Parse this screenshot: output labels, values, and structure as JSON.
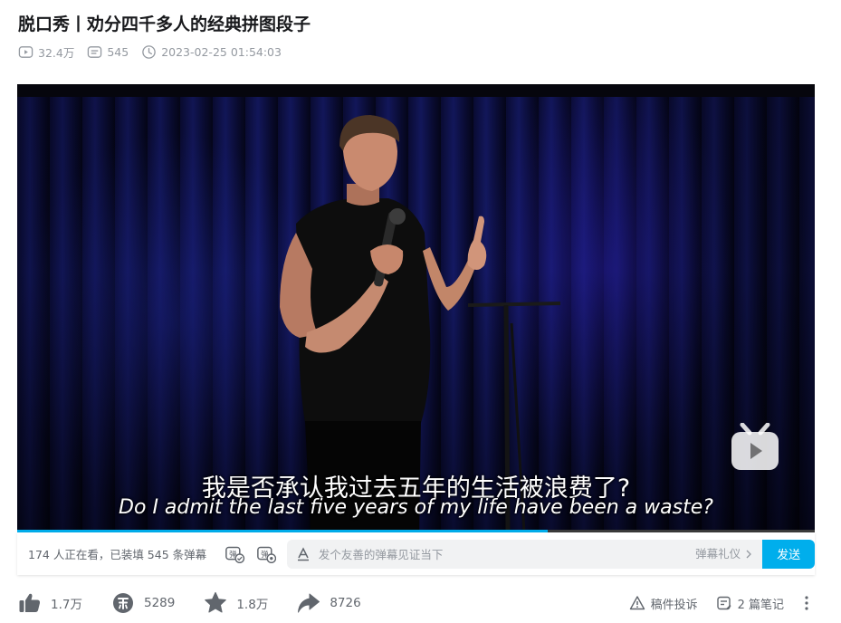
{
  "video": {
    "title": "脱口秀丨劝分四千多人的经典拼图段子",
    "views": "32.4万",
    "danmaku_count": "545",
    "publish_time": "2023-02-25 01:54:03"
  },
  "player": {
    "subtitle_cn": "我是否承认我过去五年的生活被浪费了?",
    "subtitle_en": "Do I admit the last five years of my life have been a waste?",
    "progress": 0.665
  },
  "danmaku_bar": {
    "viewers_text": "174 人正在看，已装填 545 条弹幕",
    "input_placeholder": "发个友善的弹幕见证当下",
    "etiquette_label": "弹幕礼仪",
    "send_label": "发送"
  },
  "toolbar": {
    "like_count": "1.7万",
    "coin_count": "5289",
    "favorite_count": "1.8万",
    "share_count": "8726",
    "report_label": "稿件投诉",
    "notes_label": "2 篇笔记"
  },
  "colors": {
    "accent": "#00aeec",
    "icon_dark": "#61666d",
    "muted": "#9499a0"
  },
  "icons": {
    "views": "play-count-icon",
    "danmaku": "danmaku-count-icon",
    "time": "clock-icon",
    "like": "thumbs-up-icon",
    "coin": "coin-icon",
    "favorite": "star-icon",
    "share": "share-arrow-icon",
    "report": "warning-icon",
    "notes": "notes-icon",
    "more": "more-vertical-icon"
  }
}
